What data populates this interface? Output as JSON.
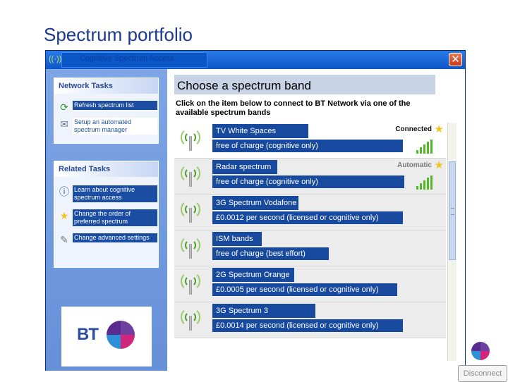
{
  "slide_title": "Spectrum portfolio",
  "window": {
    "title": "Cognitive  Spectrum Access",
    "close_glyph": "✕"
  },
  "network_tasks": {
    "heading": "Network Tasks",
    "items": [
      {
        "label": "Refresh spectrum list",
        "icon": "refresh-icon"
      },
      {
        "label": "Setup  an automated spectrum manager",
        "icon": "setup-wizard-icon"
      }
    ]
  },
  "related_tasks": {
    "heading": "Related Tasks",
    "items": [
      {
        "label": "Learn about cognitive spectrum access",
        "icon": "info-icon"
      },
      {
        "label": "Change the order of preferred spectrum",
        "icon": "star-icon"
      },
      {
        "label": "Change advanced settings",
        "icon": "settings-icon"
      }
    ]
  },
  "logo": {
    "text": "BT"
  },
  "main": {
    "header": "Choose a spectrum band",
    "description": "Click on the item below to connect to BT Network via one of the available spectrum bands"
  },
  "bands": [
    {
      "name": "TV White Spaces",
      "detail": "free of charge (cognitive only)",
      "status": "Connected",
      "signal_bars": 5,
      "starred": true
    },
    {
      "name": "Radar spectrum",
      "detail": "free of charge  (cognitive only)",
      "status": "Automatic",
      "signal_bars": 5,
      "starred": true
    },
    {
      "name": "3G Spectrum  Vodafone",
      "detail": "£0.0012 per second  (licensed or cognitive  only)",
      "status": "",
      "signal_bars": 0,
      "starred": false
    },
    {
      "name": "ISM bands",
      "detail": "free of charge (best effort)",
      "status": "",
      "signal_bars": 0,
      "starred": false
    },
    {
      "name": "2G Spectrum Orange",
      "detail": "£0.0005 per second  (licensed or cognitive only)",
      "status": "",
      "signal_bars": 0,
      "starred": false
    },
    {
      "name": "3G Spectrum  3",
      "detail": "£0.0014 per second  (licensed or cognitive  only)",
      "status": "",
      "signal_bars": 0,
      "starred": false
    }
  ],
  "buttons": {
    "disconnect": "Disconnect"
  },
  "colors": {
    "title_blue": "#1b3a8c",
    "label_blue": "#174a9f",
    "signal_green": "#55b82a"
  }
}
